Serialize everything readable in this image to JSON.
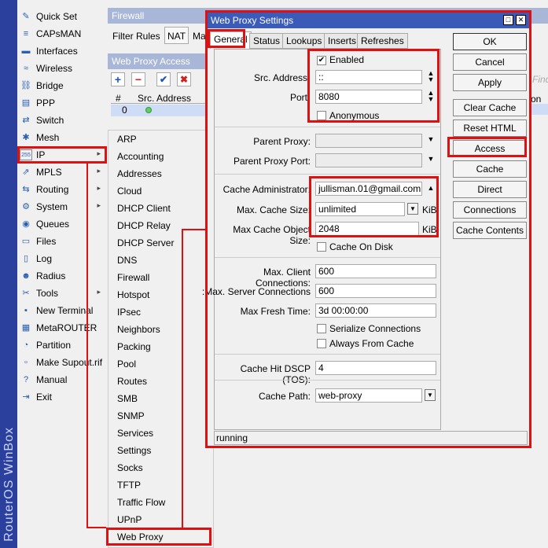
{
  "branding": {
    "vertical_text": "RouterOS WinBox"
  },
  "sidebar": {
    "items": [
      {
        "label": "Quick Set",
        "icon": "quickset-icon",
        "glyph": "✎"
      },
      {
        "label": "CAPsMAN",
        "icon": "capsman-icon",
        "glyph": "≡"
      },
      {
        "label": "Interfaces",
        "icon": "interfaces-icon",
        "glyph": "▬"
      },
      {
        "label": "Wireless",
        "icon": "wireless-icon",
        "glyph": "≈"
      },
      {
        "label": "Bridge",
        "icon": "bridge-icon",
        "glyph": "⛓"
      },
      {
        "label": "PPP",
        "icon": "ppp-icon",
        "glyph": "▤"
      },
      {
        "label": "Switch",
        "icon": "switch-icon",
        "glyph": "⇄"
      },
      {
        "label": "Mesh",
        "icon": "mesh-icon",
        "glyph": "✱"
      },
      {
        "label": "IP",
        "icon": "ip-icon",
        "glyph": "255",
        "arrow": "▸"
      },
      {
        "label": "MPLS",
        "icon": "mpls-icon",
        "glyph": "⇗",
        "arrow": "▸"
      },
      {
        "label": "Routing",
        "icon": "routing-icon",
        "glyph": "⇆",
        "arrow": "▸"
      },
      {
        "label": "System",
        "icon": "system-icon",
        "glyph": "⚙",
        "arrow": "▸"
      },
      {
        "label": "Queues",
        "icon": "queues-icon",
        "glyph": "◉"
      },
      {
        "label": "Files",
        "icon": "files-icon",
        "glyph": "▭"
      },
      {
        "label": "Log",
        "icon": "log-icon",
        "glyph": "▯"
      },
      {
        "label": "Radius",
        "icon": "radius-icon",
        "glyph": "☻"
      },
      {
        "label": "Tools",
        "icon": "tools-icon",
        "glyph": "✂",
        "arrow": "▸"
      },
      {
        "label": "New Terminal",
        "icon": "terminal-icon",
        "glyph": "▪"
      },
      {
        "label": "MetaROUTER",
        "icon": "metarouter-icon",
        "glyph": "▦"
      },
      {
        "label": "Partition",
        "icon": "partition-icon",
        "glyph": "◔"
      },
      {
        "label": "Make Supout.rif",
        "icon": "supout-icon",
        "glyph": "▫"
      },
      {
        "label": "Manual",
        "icon": "manual-icon",
        "glyph": "?"
      },
      {
        "label": "Exit",
        "icon": "exit-icon",
        "glyph": "⇥"
      }
    ]
  },
  "firewall_window": {
    "title": "Firewall",
    "tabs": [
      "Filter Rules",
      "NAT",
      "Ma"
    ]
  },
  "proxy_access_window": {
    "title": "Web Proxy Access",
    "columns": [
      "#",
      "Src. Address"
    ],
    "row": {
      "num": "0",
      "src": ""
    }
  },
  "right_hint": {
    "find": "Find",
    "col": "on"
  },
  "ip_submenu": {
    "items": [
      "ARP",
      "Accounting",
      "Addresses",
      "Cloud",
      "DHCP Client",
      "DHCP Relay",
      "DHCP Server",
      "DNS",
      "Firewall",
      "Hotspot",
      "IPsec",
      "Neighbors",
      "Packing",
      "Pool",
      "Routes",
      "SMB",
      "SNMP",
      "Services",
      "Settings",
      "Socks",
      "TFTP",
      "Traffic Flow",
      "UPnP",
      "Web Proxy"
    ]
  },
  "dialog": {
    "title": "Web Proxy Settings",
    "tabs": [
      "General",
      "Status",
      "Lookups",
      "Inserts",
      "Refreshes"
    ],
    "enabled_label": "Enabled",
    "src_address_label": "Src. Address",
    "src_address_value": "::",
    "port_label": "Port",
    "port_value": "8080",
    "anonymous_label": "Anonymous",
    "parent_proxy_label": "Parent Proxy:",
    "parent_proxy_port_label": "Parent Proxy Port:",
    "cache_admin_label": "Cache Administrator:",
    "cache_admin_value": "jullisman.01@gmail.com",
    "max_cache_size_label": "Max. Cache Size:",
    "max_cache_size_value": "unlimited",
    "max_cache_size_unit": "KiB",
    "max_cache_obj_label": "Max Cache Object Size:",
    "max_cache_obj_value": "2048",
    "max_cache_obj_unit": "KiB",
    "cache_on_disk_label": "Cache On Disk",
    "max_client_conn_label": "Max. Client Connections:",
    "max_client_conn_value": "600",
    "max_server_conn_label": "Max. Server Connections:",
    "max_server_conn_value": "600",
    "max_fresh_time_label": "Max Fresh Time:",
    "max_fresh_time_value": "3d 00:00:00",
    "serialize_label": "Serialize Connections",
    "always_cache_label": "Always From Cache",
    "dscp_label": "Cache Hit DSCP (TOS):",
    "dscp_value": "4",
    "cache_path_label": "Cache Path:",
    "cache_path_value": "web-proxy",
    "status_text": "running",
    "buttons": [
      "OK",
      "Cancel",
      "Apply",
      "Clear Cache",
      "Reset HTML",
      "Access",
      "Cache",
      "Direct",
      "Connections",
      "Cache Contents"
    ]
  }
}
